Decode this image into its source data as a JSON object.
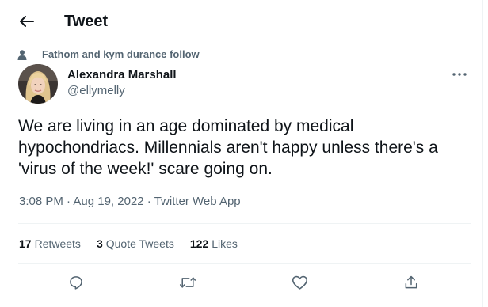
{
  "header": {
    "title": "Tweet",
    "back_icon": "arrow-left-icon"
  },
  "social_context": {
    "icon": "person-icon",
    "text": "Fathom and kym durance follow"
  },
  "author": {
    "name": "Alexandra Marshall",
    "handle": "@ellymelly",
    "avatar": "profile-photo"
  },
  "more_icon": "ellipsis-icon",
  "tweet": {
    "text": "We are living in an age dominated by medical hypochondriacs. Millennials aren't happy unless there's a 'virus of the week!' scare going on.",
    "time": "3:08 PM",
    "dot1": " · ",
    "date": "Aug 19, 2022",
    "dot2": " · ",
    "source": "Twitter Web App"
  },
  "stats": {
    "retweets_count": "17",
    "retweets_label": "Retweets",
    "quotes_count": "3",
    "quotes_label": "Quote Tweets",
    "likes_count": "122",
    "likes_label": "Likes"
  },
  "actions": [
    "reply-icon",
    "retweet-icon",
    "like-icon",
    "share-icon"
  ],
  "colors": {
    "text": "#0f1419",
    "secondary": "#536471",
    "divider": "#eff3f4"
  }
}
